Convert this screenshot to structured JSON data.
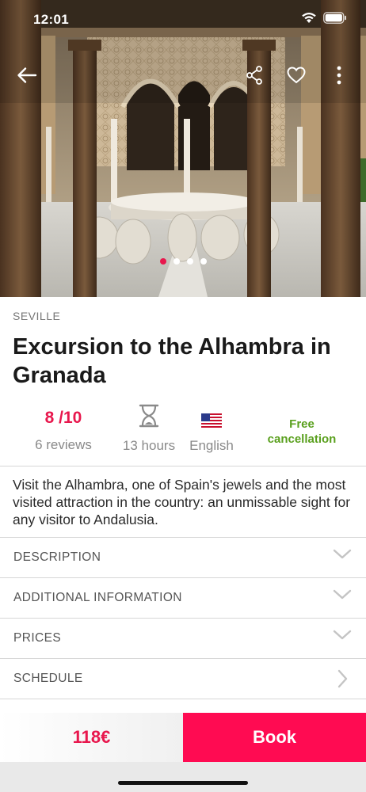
{
  "status_bar": {
    "time": "12:01"
  },
  "hero": {
    "photo_subject": "Court of the Lions",
    "carousel": {
      "count": 4,
      "active_index": 0
    }
  },
  "header_icons": [
    "back-arrow-icon",
    "share-icon",
    "heart-icon",
    "more-vertical-icon"
  ],
  "tour": {
    "city": "SEVILLE",
    "title": "Excursion to the Alhambra in Granada",
    "rating": "8 /10",
    "reviews": "6 reviews",
    "duration": "13 hours",
    "language": "English",
    "cancellation": "Free cancellation",
    "summary": "Visit the Alhambra, one of Spain's jewels and the most visited attraction in the country: an unmissable sight for any visitor to Andalusia."
  },
  "sections": [
    {
      "label": "DESCRIPTION",
      "icon": "chevron-down-icon"
    },
    {
      "label": "ADDITIONAL INFORMATION",
      "icon": "chevron-down-icon"
    },
    {
      "label": "PRICES",
      "icon": "chevron-down-icon"
    },
    {
      "label": "SCHEDULE",
      "icon": "chevron-right-icon"
    }
  ],
  "bottom_bar": {
    "price": "118€",
    "book_label": "Book"
  },
  "colors": {
    "accent": "#e8174d",
    "book_button": "#ff0b52",
    "cancellation_green": "#5aa01e",
    "muted_text": "#8a8a8a"
  }
}
